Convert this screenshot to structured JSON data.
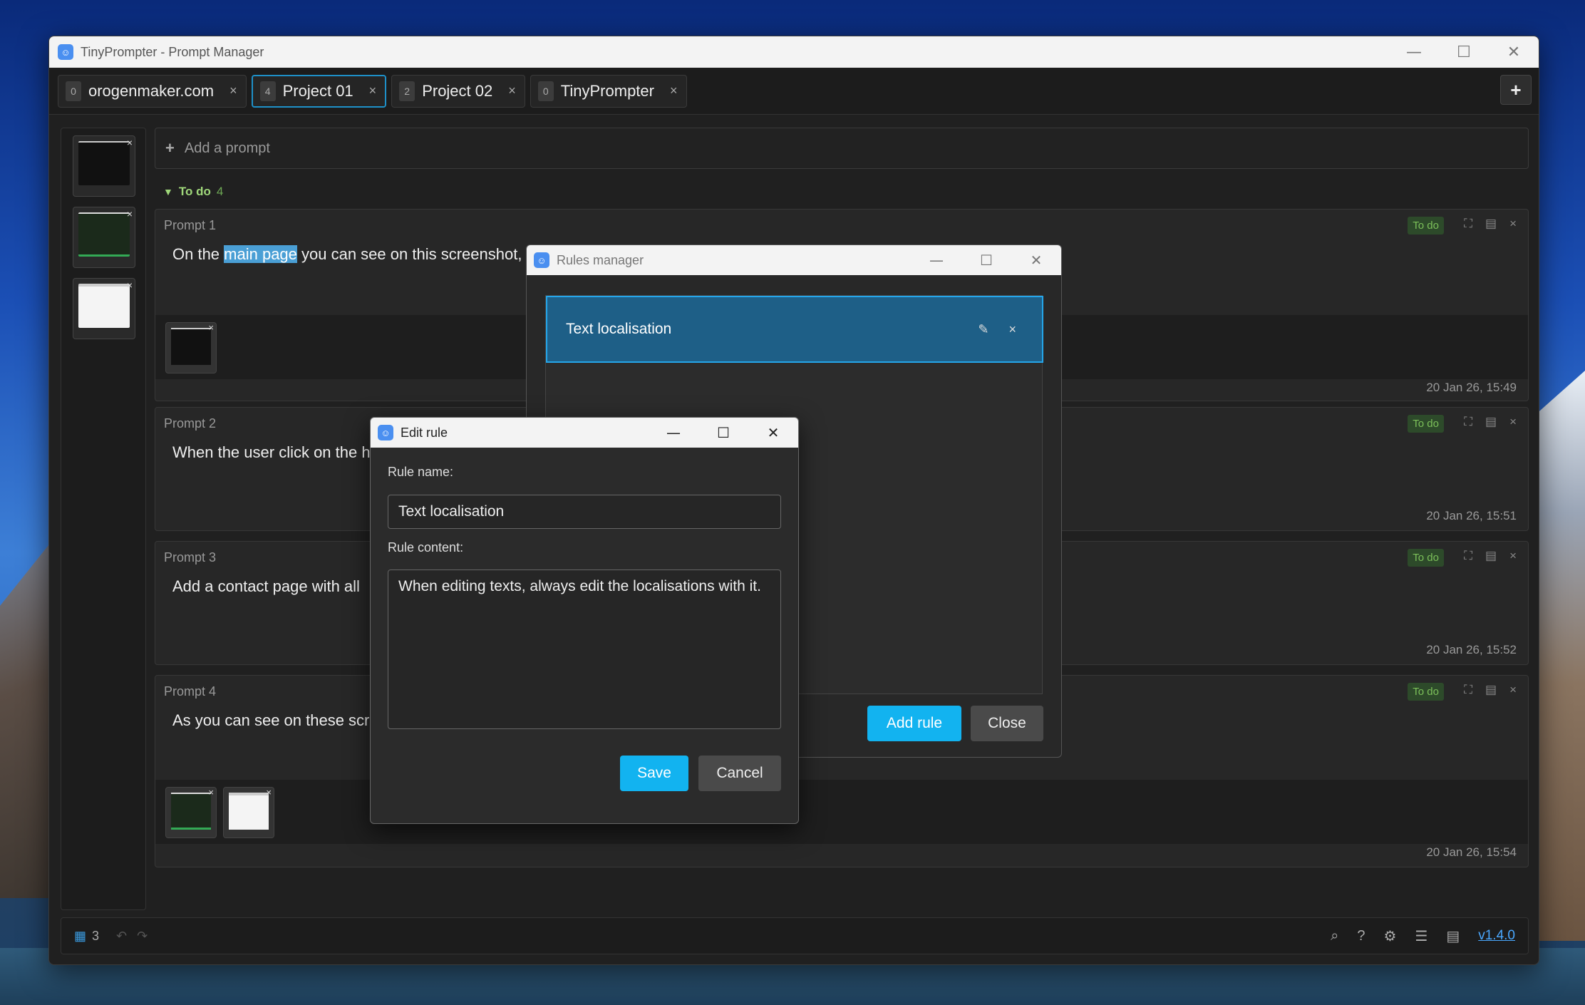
{
  "window": {
    "title": "TinyPrompter - Prompt Manager",
    "controls": {
      "minimize": "—",
      "maximize": "☐",
      "close": "✕"
    }
  },
  "tabs": [
    {
      "count": "0",
      "label": "orogenmaker.com",
      "close": "×"
    },
    {
      "count": "4",
      "label": "Project 01",
      "close": "×"
    },
    {
      "count": "2",
      "label": "Project 02",
      "close": "×"
    },
    {
      "count": "0",
      "label": "TinyPrompter",
      "close": "×"
    }
  ],
  "add_tab": "+",
  "add_prompt": {
    "icon": "+",
    "placeholder": "Add a prompt"
  },
  "section": {
    "label": "To do",
    "count": "4",
    "icon": "▼"
  },
  "prompts": [
    {
      "title": "Prompt 1",
      "text_before": "On the ",
      "text_highlight": "main page",
      "text_after": " you can see on this screenshot,",
      "status": "To do",
      "date": "20 Jan 26, 15:49"
    },
    {
      "title": "Prompt 2",
      "text": "When the user click on the h",
      "status": "To do",
      "date": "20 Jan 26, 15:51"
    },
    {
      "title": "Prompt 3",
      "text": "Add a contact page with all",
      "status": "To do",
      "date": "20 Jan 26, 15:52"
    },
    {
      "title": "Prompt 4",
      "text": "As you can see on these scr",
      "status": "To do",
      "date": "20 Jan 26, 15:54"
    }
  ],
  "card_actions": {
    "expand": "⛶",
    "copy": "▤",
    "delete": "×"
  },
  "thumb_close": "×",
  "statusbar": {
    "image_count": "3",
    "grid_icon": "▦",
    "undo": "↶",
    "redo": "↷",
    "icons": {
      "search": "⌕",
      "help": "?",
      "settings": "⚙",
      "menu": "☰",
      "list": "▤"
    },
    "version": "v1.4.0"
  },
  "rules_manager": {
    "title": "Rules manager",
    "rule": {
      "name": "Text localisation",
      "edit_icon": "✎",
      "delete_icon": "×"
    },
    "add_button": "Add rule",
    "close_button": "Close"
  },
  "edit_rule": {
    "title": "Edit rule",
    "name_label": "Rule name:",
    "name_value": "Text localisation",
    "content_label": "Rule content:",
    "content_value": "When editing texts, always edit the localisations with it.",
    "save_button": "Save",
    "cancel_button": "Cancel"
  }
}
